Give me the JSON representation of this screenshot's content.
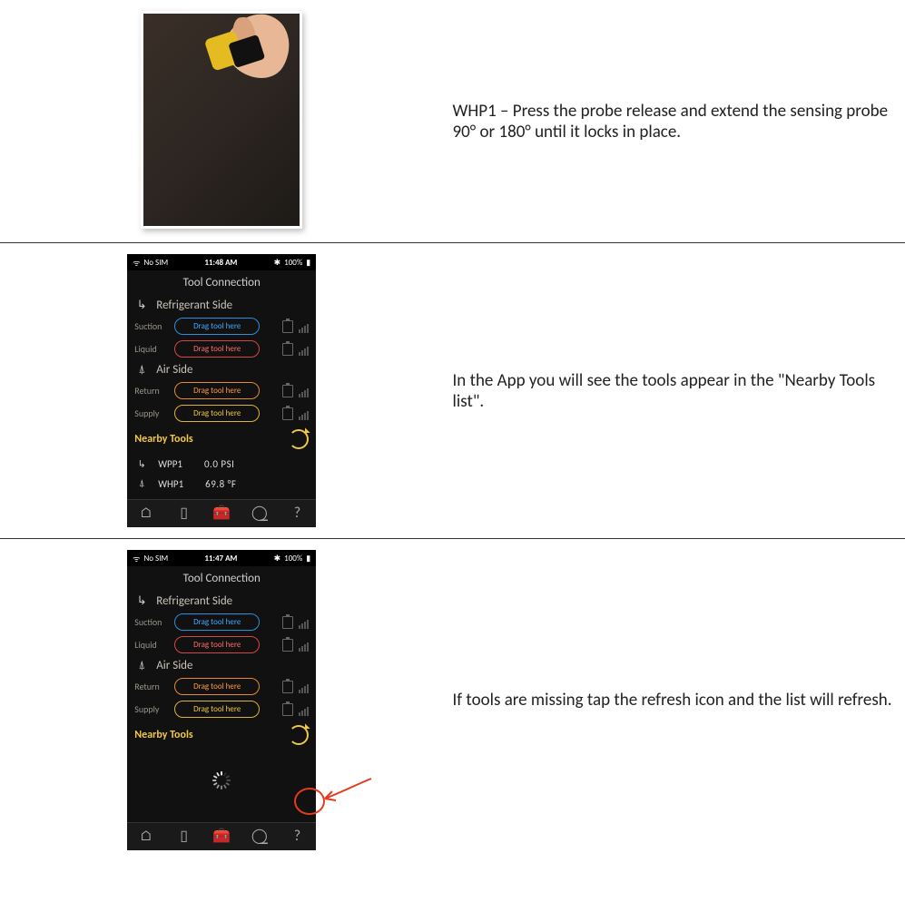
{
  "row1": {
    "text": "WHP1 – Press the probe release and extend the sensing probe 90° or 180° until it locks in place."
  },
  "row2": {
    "text": "In the App you will see the tools appear in the \"Nearby Tools list\"."
  },
  "row3": {
    "text": "If tools are missing tap the refresh icon and the list will refresh."
  },
  "phoneA": {
    "status": {
      "left": "No SIM",
      "time": "11:48 AM",
      "right": "100%"
    },
    "title": "Tool Connection",
    "refrigerant": {
      "header": "Refrigerant Side",
      "suction_label": "Suction",
      "suction_drop": "Drag tool here",
      "liquid_label": "Liquid",
      "liquid_drop": "Drag tool here"
    },
    "air": {
      "header": "Air Side",
      "return_label": "Return",
      "return_drop": "Drag tool here",
      "supply_label": "Supply",
      "supply_drop": "Drag tool here"
    },
    "nearby": {
      "header": "Nearby Tools",
      "tools": [
        {
          "name": "WPP1",
          "value": "0.0 PSI"
        },
        {
          "name": "WHP1",
          "value": "69.8 °F"
        }
      ]
    }
  },
  "phoneB": {
    "status": {
      "left": "No SIM",
      "time": "11:47 AM",
      "right": "100%"
    },
    "title": "Tool Connection",
    "refrigerant": {
      "header": "Refrigerant Side",
      "suction_label": "Suction",
      "suction_drop": "Drag tool here",
      "liquid_label": "Liquid",
      "liquid_drop": "Drag tool here"
    },
    "air": {
      "header": "Air Side",
      "return_label": "Return",
      "return_drop": "Drag tool here",
      "supply_label": "Supply",
      "supply_drop": "Drag tool here"
    },
    "nearby": {
      "header": "Nearby Tools"
    }
  }
}
